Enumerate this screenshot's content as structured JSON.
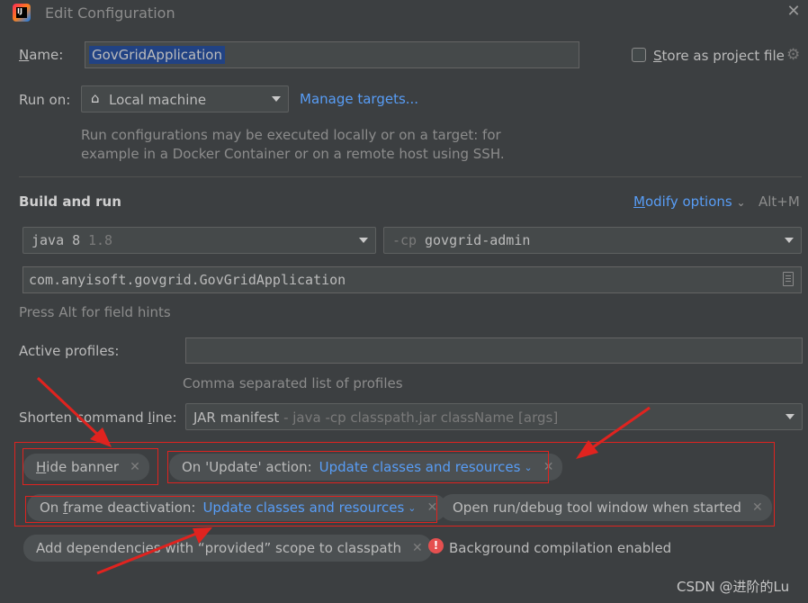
{
  "window": {
    "title": "Edit Configuration",
    "close_icon": "close-icon"
  },
  "name": {
    "label": "Name:",
    "value": "GovGridApplication"
  },
  "store_project": {
    "label": "Store as project file",
    "checked": false
  },
  "run_on": {
    "label": "Run on:",
    "value": "Local machine",
    "manage_targets": "Manage targets...",
    "description_line1": "Run configurations may be executed locally or on a target: for",
    "description_line2": "example in a Docker Container or on a remote host using SSH."
  },
  "build_and_run": {
    "title": "Build and run",
    "modify_options": "Modify options",
    "modify_shortcut": "Alt+M",
    "jdk": {
      "name": "java 8",
      "version": "1.8"
    },
    "classpath": {
      "flag": "-cp",
      "module": "govgrid-admin"
    },
    "main_class": "com.anyisoft.govgrid.GovGridApplication",
    "field_hint": "Press Alt for field hints"
  },
  "active_profiles": {
    "label": "Active profiles:",
    "value": "",
    "hint": "Comma separated list of profiles"
  },
  "shorten_cmd": {
    "label": "Shorten command line:",
    "value": "JAR manifest",
    "detail": " - java -cp classpath.jar className [args]"
  },
  "options": {
    "hide_banner": "Hide banner",
    "on_update_label": "On 'Update' action:",
    "on_update_value": "Update classes and resources",
    "on_frame_label": "On frame deactivation:",
    "on_frame_value": "Update classes and resources",
    "open_tool_window": "Open run/debug tool window when started",
    "add_dependencies": "Add dependencies with “provided” scope to classpath",
    "bg_compilation": "Background compilation enabled"
  },
  "watermark": "CSDN @进阶的Lu",
  "colors": {
    "accent_link": "#589df6",
    "annotation_red": "#e0231f",
    "background": "#3c3f41"
  }
}
